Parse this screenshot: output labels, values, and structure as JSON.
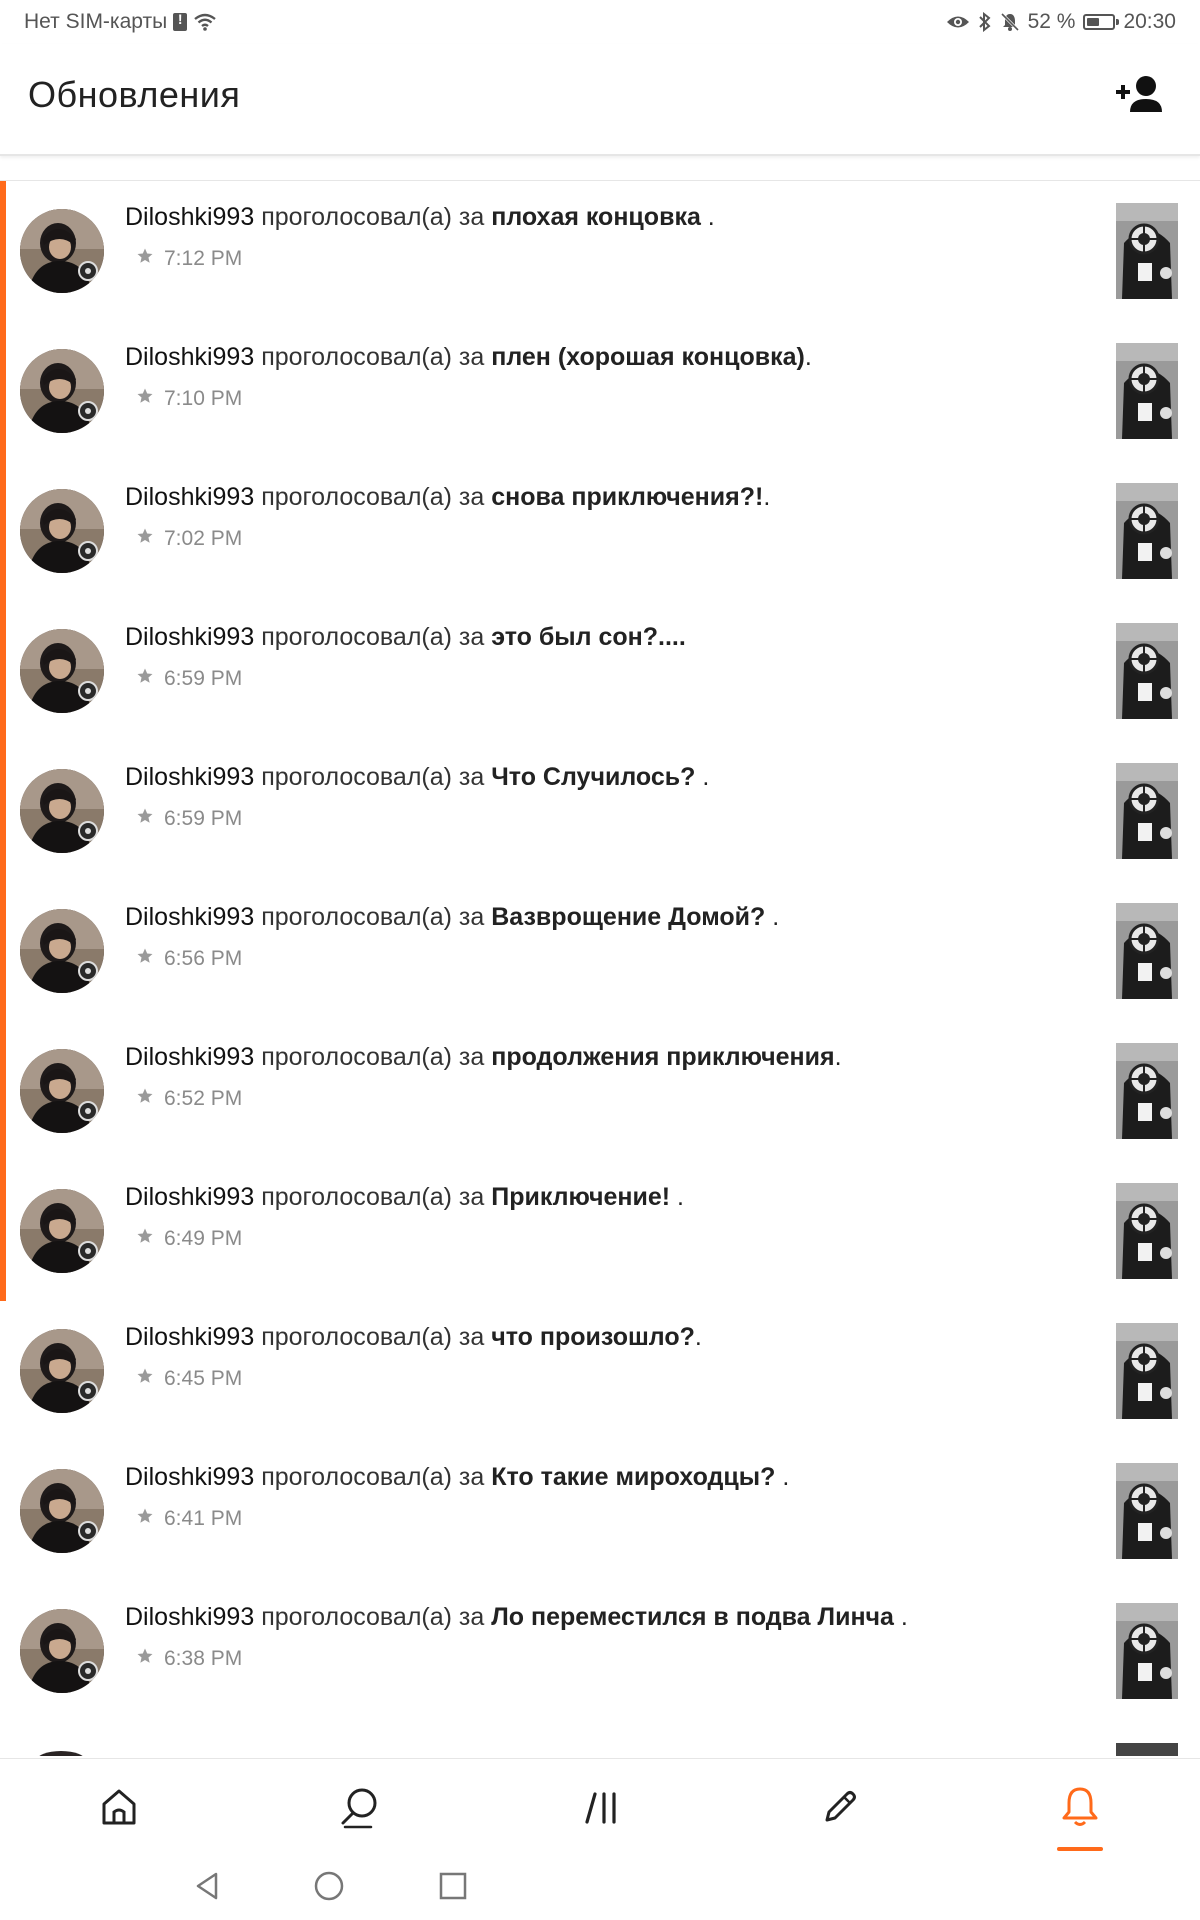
{
  "status_bar": {
    "carrier": "Нет SIM-карты",
    "battery_percent": "52 %",
    "battery_level": 0.52,
    "time": "20:30",
    "icons": [
      "sim-alert-icon",
      "wifi-icon",
      "eye-icon",
      "bluetooth-icon",
      "bell-off-icon",
      "battery-icon"
    ]
  },
  "header": {
    "title": "Обновления",
    "action_icon": "add-user-icon"
  },
  "colors": {
    "accent": "#ff6a1a",
    "text": "#222222",
    "muted": "#8a8a8a",
    "divider": "#e6e6e6"
  },
  "notifications": [
    {
      "user": "Diloshki993",
      "verb": " проголосовал(а) за ",
      "target": "плохая концовка",
      "suffix": " .",
      "time": "7:12 PM",
      "unread": true
    },
    {
      "user": "Diloshki993",
      "verb": " проголосовал(а) за ",
      "target": "плен (хорошая концовка)",
      "suffix": ".",
      "time": "7:10 PM",
      "unread": true
    },
    {
      "user": "Diloshki993",
      "verb": " проголосовал(а) за ",
      "target": "снова приключения?!",
      "suffix": ".",
      "time": "7:02 PM",
      "unread": true
    },
    {
      "user": "Diloshki993",
      "verb": " проголосовал(а) за ",
      "target": "это был сон?....",
      "suffix": "",
      "time": "6:59 PM",
      "unread": true
    },
    {
      "user": "Diloshki993",
      "verb": " проголосовал(а) за ",
      "target": "Что Случилось?",
      "suffix": " .",
      "time": "6:59 PM",
      "unread": true
    },
    {
      "user": "Diloshki993",
      "verb": " проголосовал(а) за ",
      "target": "Вазврощение Домой?",
      "suffix": " .",
      "time": "6:56 PM",
      "unread": true
    },
    {
      "user": "Diloshki993",
      "verb": " проголосовал(а) за ",
      "target": "продолжения приключения",
      "suffix": ".",
      "time": "6:52 PM",
      "unread": true
    },
    {
      "user": "Diloshki993",
      "verb": " проголосовал(а) за ",
      "target": "Приключение!",
      "suffix": " .",
      "time": "6:49 PM",
      "unread": true
    },
    {
      "user": "Diloshki993",
      "verb": " проголосовал(а) за ",
      "target": "что произошло?",
      "suffix": ".",
      "time": "6:45 PM",
      "unread": false
    },
    {
      "user": "Diloshki993",
      "verb": " проголосовал(а) за ",
      "target": "Кто такие мироходцы?",
      "suffix": " .",
      "time": "6:41 PM",
      "unread": false
    },
    {
      "user": "Diloshki993",
      "verb": " проголосовал(а) за ",
      "target": "Ло переместился в подва Линча",
      "suffix": " .",
      "time": "6:38 PM",
      "unread": false
    }
  ],
  "bottom_nav": {
    "items": [
      {
        "name": "home",
        "icon": "home-icon",
        "active": false
      },
      {
        "name": "search",
        "icon": "search-icon",
        "active": false
      },
      {
        "name": "library",
        "icon": "library-icon",
        "active": false
      },
      {
        "name": "write",
        "icon": "pencil-icon",
        "active": false
      },
      {
        "name": "notifications",
        "icon": "bell-icon",
        "active": true
      }
    ]
  },
  "system_nav": {
    "icons": [
      "back-icon",
      "home-circle-icon",
      "recents-icon"
    ]
  }
}
